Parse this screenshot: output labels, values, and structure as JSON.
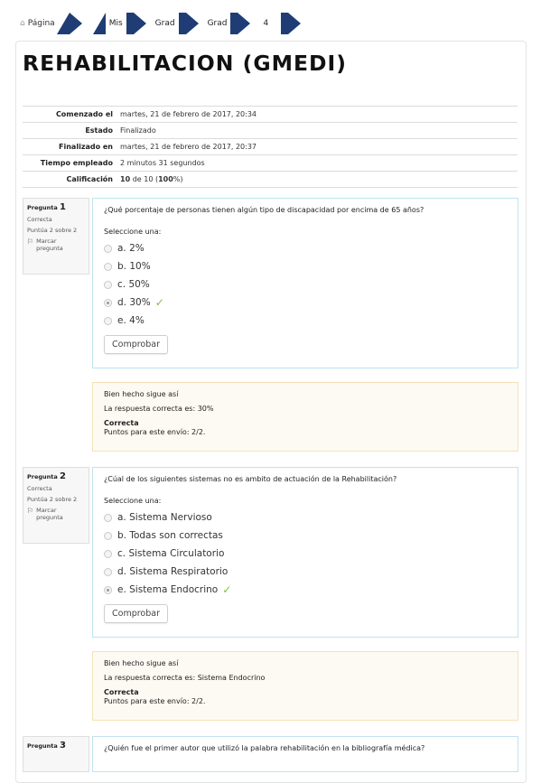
{
  "breadcrumb": {
    "home": "Página",
    "items": [
      "Mis",
      "Grad",
      "Grad",
      "4"
    ]
  },
  "title": "REHABILITACION (GMEDI)",
  "summary": [
    {
      "key": "Comenzado el",
      "value": "martes, 21 de febrero de 2017, 20:34"
    },
    {
      "key": "Estado",
      "value": "Finalizado"
    },
    {
      "key": "Finalizado en",
      "value": "martes, 21 de febrero de 2017, 20:37"
    },
    {
      "key": "Tiempo empleado",
      "value": "2 minutos 31 segundos"
    },
    {
      "key": "Calificación",
      "value_bold": "10",
      "value_mid": "de 10 (",
      "value_pct": "100",
      "value_end": "%)"
    }
  ],
  "questions": [
    {
      "label": "Pregunta",
      "number": "1",
      "status": "Correcta",
      "score": "Puntúa 2 sobre 2",
      "flag": "Marcar pregunta",
      "text": "¿Qué porcentaje de personas tienen algún tipo de discapacidad por encima de 65 años?",
      "prompt": "Seleccione una:",
      "answers": [
        "a. 2%",
        "b. 10%",
        "c. 50%",
        "d. 30%",
        "e. 4%"
      ],
      "selected": 3,
      "button": "Comprobar",
      "feedback": {
        "general": "Bien hecho sigue así",
        "right_answer": "La respuesta correcta es: 30%",
        "state": "Correcta",
        "points": "Puntos para este envío: 2/2."
      }
    },
    {
      "label": "Pregunta",
      "number": "2",
      "status": "Correcta",
      "score": "Puntúa 2 sobre 2",
      "flag": "Marcar pregunta",
      "text": "¿Cúal de los siguientes sistemas no es ambito de actuación de la Rehabilitación?",
      "prompt": "Seleccione una:",
      "answers": [
        "a. Sistema Nervioso",
        "b. Todas son correctas",
        "c. Sistema Circulatorio",
        "d. Sistema Respiratorio",
        "e. Sistema Endocrino"
      ],
      "selected": 4,
      "button": "Comprobar",
      "feedback": {
        "general": "Bien hecho sigue así",
        "right_answer": "La respuesta correcta es: Sistema Endocrino",
        "state": "Correcta",
        "points": "Puntos para este envío: 2/2."
      }
    },
    {
      "label": "Pregunta",
      "number": "3",
      "text": "¿Quién fue el primer autor que utilizó la palabra rehabilitación en la bibliografía médica?"
    }
  ],
  "icons": {
    "home": "home-icon",
    "flag": "flag-icon",
    "check": "check-icon"
  },
  "colors": {
    "breadcrumb": "#1f3c74",
    "check": "#7dc242",
    "question_border": "#bfe3f0",
    "feedback_bg": "#fcfaf3",
    "feedback_border": "#f6e2b8"
  }
}
